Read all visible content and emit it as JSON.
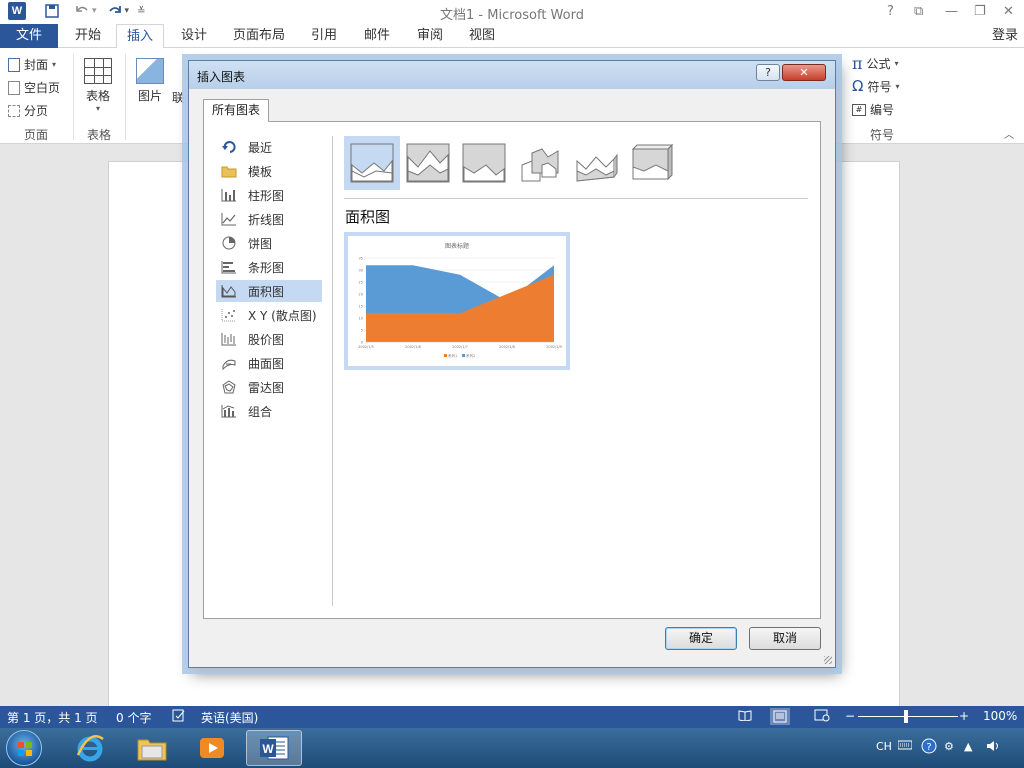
{
  "window": {
    "title": "文档1 - Microsoft Word",
    "help": "?",
    "controls": [
      "⧉",
      "—",
      "❐",
      "✕"
    ]
  },
  "ribbon": {
    "tabs": [
      "文件",
      "开始",
      "插入",
      "设计",
      "页面布局",
      "引用",
      "邮件",
      "审阅",
      "视图"
    ],
    "active_tab": "插入",
    "login": "登录",
    "groups": {
      "pages": {
        "label": "页面",
        "items": [
          "封面",
          "空白页",
          "分页"
        ]
      },
      "tables": {
        "label": "表格",
        "item": "表格"
      },
      "illustrations": {
        "items": [
          "图片",
          "联"
        ]
      },
      "symbols": {
        "label": "符号",
        "items": [
          "公式",
          "符号",
          "编号"
        ]
      }
    }
  },
  "dialog": {
    "title": "插入图表",
    "help": "?",
    "close": "✕",
    "tab": "所有图表",
    "categories": [
      {
        "label": "最近",
        "icon": "recent-icon"
      },
      {
        "label": "模板",
        "icon": "folder-icon"
      },
      {
        "label": "柱形图",
        "icon": "column-chart-icon"
      },
      {
        "label": "折线图",
        "icon": "line-chart-icon"
      },
      {
        "label": "饼图",
        "icon": "pie-chart-icon"
      },
      {
        "label": "条形图",
        "icon": "bar-chart-icon"
      },
      {
        "label": "面积图",
        "icon": "area-chart-icon"
      },
      {
        "label": "X Y (散点图)",
        "icon": "scatter-chart-icon"
      },
      {
        "label": "股价图",
        "icon": "stock-chart-icon"
      },
      {
        "label": "曲面图",
        "icon": "surface-chart-icon"
      },
      {
        "label": "雷达图",
        "icon": "radar-chart-icon"
      },
      {
        "label": "组合",
        "icon": "combo-chart-icon"
      }
    ],
    "selected_category": "面积图",
    "subtypes": [
      "area",
      "stacked-area",
      "100-stacked-area",
      "3d-area",
      "3d-stacked-area",
      "3d-100-stacked-area"
    ],
    "section_title": "面积图",
    "ok": "确定",
    "cancel": "取消"
  },
  "chart_data": {
    "type": "area",
    "title": "图表标题",
    "categories": [
      "2002/1/5",
      "2002/1/6",
      "2002/1/7",
      "2002/1/8",
      "2002/1/9"
    ],
    "series": [
      {
        "name": "系列2",
        "values": [
          32,
          32,
          28,
          17,
          32
        ],
        "color": "#5b9bd5"
      },
      {
        "name": "系列1",
        "values": [
          12,
          12,
          12,
          20,
          28
        ],
        "color": "#ed7d31"
      }
    ],
    "ylim": [
      0,
      35
    ],
    "yticks": [
      0,
      5,
      10,
      15,
      20,
      25,
      30,
      35
    ],
    "legend": "bottom"
  },
  "statusbar": {
    "page": "第 1 页，共 1 页",
    "words": "0 个字",
    "language": "英语(美国)",
    "zoom": "100%",
    "zoom_minus": "−",
    "zoom_plus": "+"
  },
  "taskbar": {
    "tray_lang": "CH"
  }
}
